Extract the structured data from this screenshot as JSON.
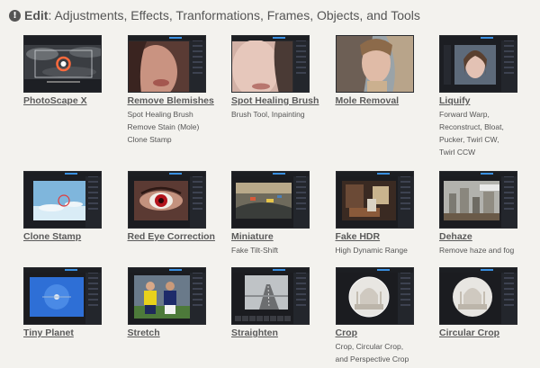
{
  "header": {
    "title_bold": "Edit",
    "title_rest": ": Adjustments, Effects, Tranformations, Frames, Objects, and Tools"
  },
  "colors": {
    "background": "#f3f2ee",
    "thumb_bg": "#15171c",
    "accent": "#3a8fe0",
    "text": "#555555"
  },
  "items": [
    {
      "label": "PhotoScape X",
      "desc": [],
      "icon": "photoscape-thumbnail"
    },
    {
      "label": "Remove Blemishes",
      "desc": [
        "Spot Healing Brush",
        "Remove Stain (Mole)",
        "Clone Stamp"
      ],
      "icon": "face-closeup-thumbnail"
    },
    {
      "label": "Spot Healing Brush",
      "desc": [
        "Brush Tool, Inpainting"
      ],
      "icon": "face-closeup-thumbnail"
    },
    {
      "label": "Mole Removal",
      "desc": [],
      "icon": "woman-portrait-thumbnail"
    },
    {
      "label": "Liquify",
      "desc": [
        "Forward Warp,",
        "Reconstruct, Bloat,",
        "Pucker, Twirl CW,",
        "Twirl CCW"
      ],
      "icon": "portrait-editor-thumbnail"
    },
    {
      "label": "Clone Stamp",
      "desc": [],
      "icon": "sky-editor-thumbnail"
    },
    {
      "label": "Red Eye Correction",
      "desc": [],
      "icon": "red-eye-thumbnail"
    },
    {
      "label": "Miniature",
      "desc": [
        "Fake Tilt-Shift"
      ],
      "icon": "miniature-thumbnail"
    },
    {
      "label": "Fake HDR",
      "desc": [
        "High Dynamic Range"
      ],
      "icon": "hdr-room-thumbnail"
    },
    {
      "label": "Dehaze",
      "desc": [
        "Remove haze and fog"
      ],
      "icon": "foggy-city-thumbnail"
    },
    {
      "label": "Tiny Planet",
      "desc": [],
      "icon": "tiny-planet-thumbnail"
    },
    {
      "label": "Stretch",
      "desc": [],
      "icon": "soccer-players-thumbnail"
    },
    {
      "label": "Straighten",
      "desc": [],
      "icon": "road-thumbnail"
    },
    {
      "label": "Crop",
      "desc": [
        "Crop, Circular Crop,",
        "and Perspective Crop"
      ],
      "icon": "taj-mahal-thumbnail"
    },
    {
      "label": "Circular Crop",
      "desc": [],
      "icon": "taj-mahal-circle-thumbnail"
    }
  ]
}
